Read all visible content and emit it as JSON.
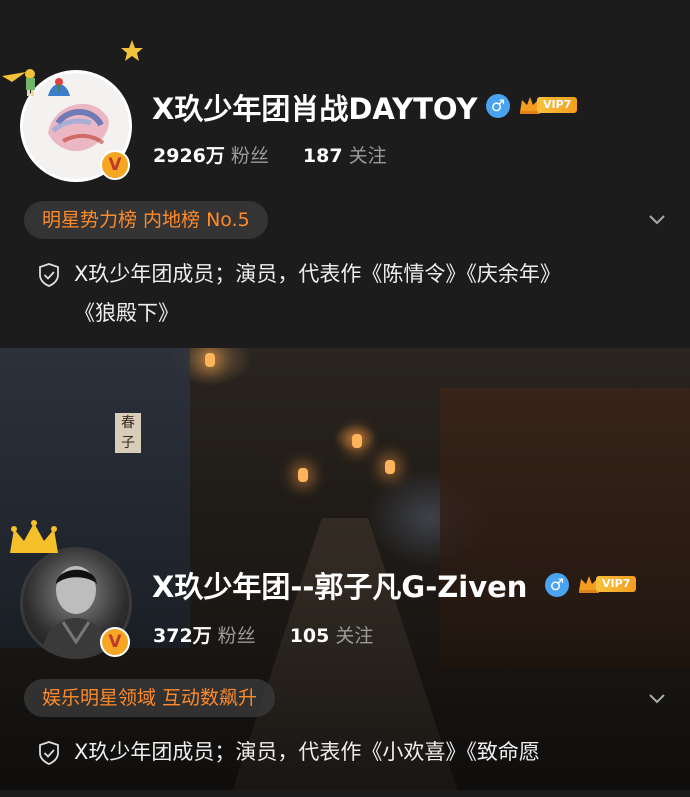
{
  "profiles": [
    {
      "name": "X玖少年团肖战DAYTOY",
      "gender_icon": "♂",
      "vip_label": "VIP7",
      "verified_badge": "V",
      "followers_count": "2926万",
      "followers_label": "粉丝",
      "following_count": "187",
      "following_label": "关注",
      "rank": "明星势力榜 内地榜 No.5",
      "intro_lines": [
        "X玖少年团成员；演员，代表作《陈情令》《庆余年》",
        "《狼殿下》"
      ]
    },
    {
      "name": "X玖少年团--郭子凡G-Ziven",
      "gender_icon": "♂",
      "vip_label": "VIP7",
      "verified_badge": "V",
      "followers_count": "372万",
      "followers_label": "粉丝",
      "following_count": "105",
      "following_label": "关注",
      "rank": "娱乐明星领域 互动数飙升",
      "intro_lines": [
        "X玖少年团成员；演员，代表作《小欢喜》《致命愿"
      ]
    }
  ],
  "background_sign": "春子",
  "colors": {
    "rank_text": "#ff8a2a",
    "gender_badge": "#4aa3f0",
    "verified_badge": "#f5a623",
    "vip": "#f7c23c"
  }
}
